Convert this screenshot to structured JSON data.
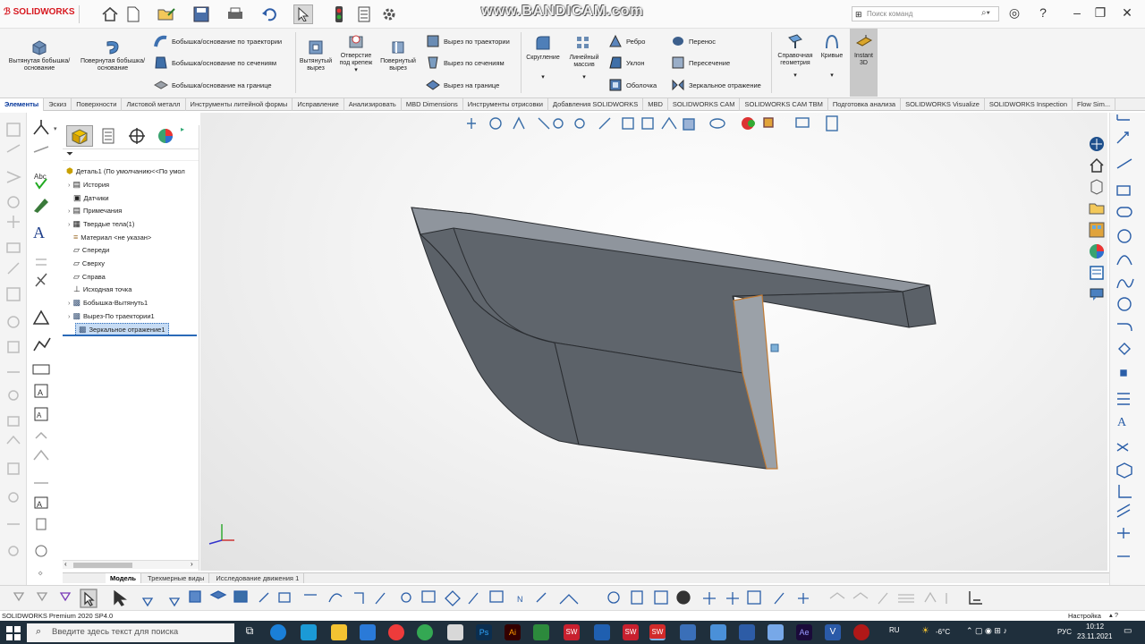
{
  "app": {
    "logo_text": "SOLIDWORKS",
    "watermark": "www.BANDICAM.com",
    "search_placeholder": "Поиск команд",
    "accent": "#d71920"
  },
  "ribbon": {
    "big": [
      "Вытянутая бобышка/основание",
      "Повернутая бобышка/основание",
      "Вытянутый вырез",
      "Отверстие под крепеж",
      "Повернутый вырез",
      "Скругление",
      "Линейный массив",
      "Справочная геометрия",
      "Кривые",
      "Instant 3D"
    ],
    "boss": [
      "Бобышка/основание по траектории",
      "Бобышка/основание по сечениям",
      "Бобышка/основание на границе"
    ],
    "cut": [
      "Вырез по траектории",
      "Вырез по сечениям",
      "Вырез на границе"
    ],
    "feat": [
      "Ребро",
      "Уклон",
      "Оболочка"
    ],
    "feat2": [
      "Перенос",
      "Пересечение",
      "Зеркальное отражение"
    ]
  },
  "tabs": [
    "Элементы",
    "Эскиз",
    "Поверхности",
    "Листовой металл",
    "Инструменты литейной формы",
    "Исправление",
    "Анализировать",
    "MBD Dimensions",
    "Инструменты отрисовки",
    "Добавления SOLIDWORKS",
    "MBD",
    "SOLIDWORKS CAM",
    "SOLIDWORKS CAM TBM",
    "Подготовка анализа",
    "SOLIDWORKS Visualize",
    "SOLIDWORKS Inspection",
    "Flow Sim..."
  ],
  "tree": {
    "root": "Деталь1 (По умолчанию<<По умол",
    "items": [
      "История",
      "Датчики",
      "Примечания",
      "Твердые тела(1)",
      "Материал <не указан>",
      "Спереди",
      "Сверху",
      "Справа",
      "Исходная точка",
      "Бобышка-Вытянуть1",
      "Вырез-По траектории1",
      "Зеркальное отражение1"
    ]
  },
  "bottom_tabs": [
    "Модель",
    "Трехмерные виды",
    "Исследование движения 1"
  ],
  "status": {
    "left": "SOLIDWORKS Premium 2020 SP4.0",
    "right": "Настройка"
  },
  "taskbar": {
    "search": "Введите здесь текст для поиска",
    "lang": "RU",
    "weather": "-6°C",
    "kbd": "РУС",
    "time": "10:12",
    "date": "23.11.2021"
  }
}
